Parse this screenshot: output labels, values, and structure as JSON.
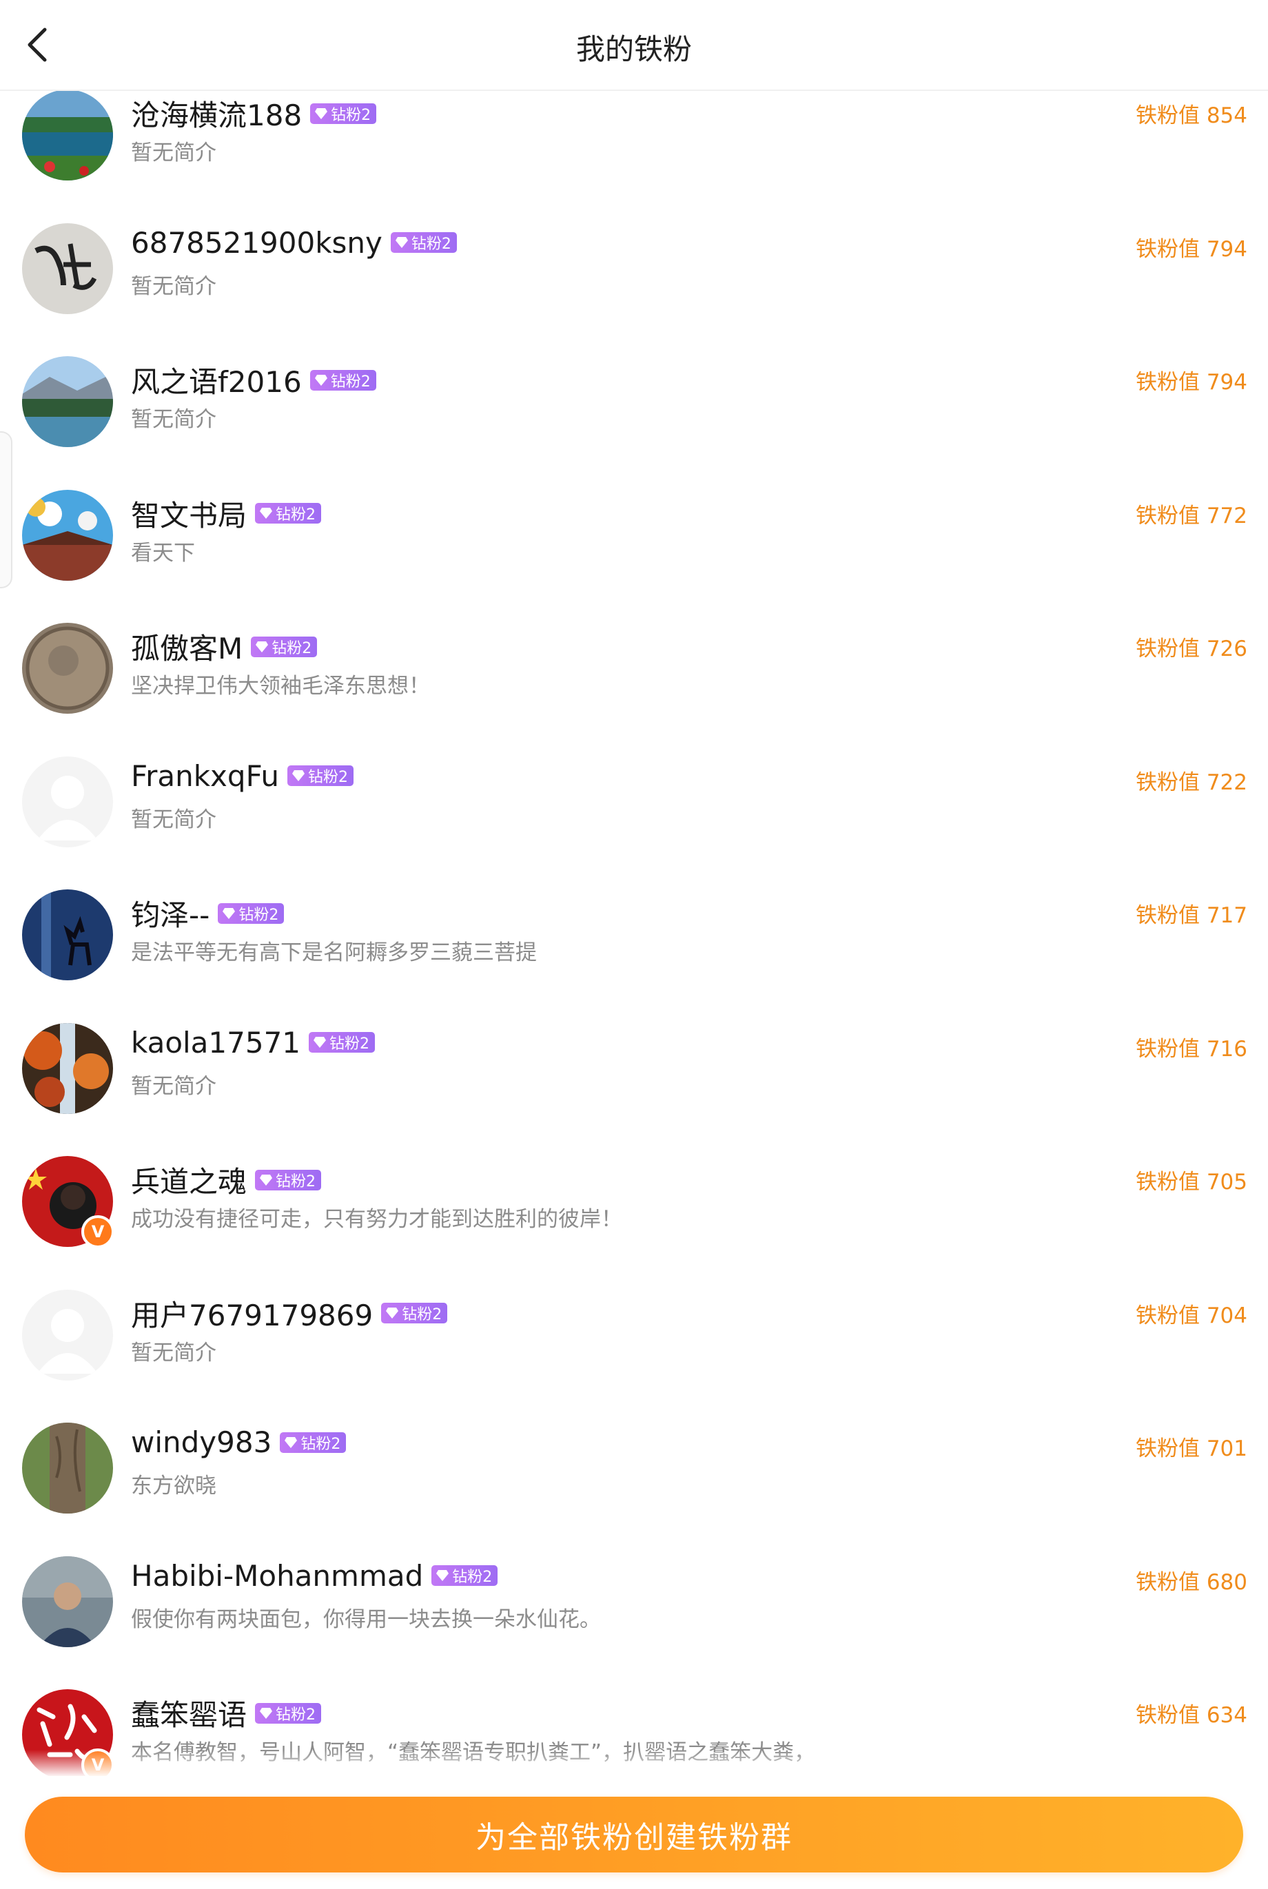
{
  "header": {
    "title": "我的铁粉"
  },
  "badge_label": "钻粉2",
  "colors": {
    "accent": "#f08c1c",
    "badge": "#b070f4",
    "cta_start": "#ff8a1f",
    "cta_end": "#ffb22a"
  },
  "fans": [
    {
      "name": "沧海横流188",
      "bio": "暂无简介",
      "score": "铁粉值 854",
      "avatar": "lake-landscape",
      "verified": false
    },
    {
      "name": "6878521900ksny",
      "bio": "暂无简介",
      "score": "铁粉值 794",
      "avatar": "calligraphy",
      "verified": false
    },
    {
      "name": "风之语f2016",
      "bio": "暂无简介",
      "score": "铁粉值 794",
      "avatar": "river-forest",
      "verified": false
    },
    {
      "name": "智文书局",
      "bio": "看天下",
      "score": "铁粉值 772",
      "avatar": "pavilion-sky",
      "verified": false
    },
    {
      "name": "孤傲客M",
      "bio": "坚决捍卫伟大领袖毛泽东思想！",
      "score": "铁粉值 726",
      "avatar": "old-coin",
      "verified": false
    },
    {
      "name": "FrankxqFu",
      "bio": "暂无简介",
      "score": "铁粉值 722",
      "avatar": "default-user",
      "verified": false
    },
    {
      "name": "钧泽--",
      "bio": "是法平等无有高下是名阿耨多罗三藐三菩提",
      "score": "铁粉值 717",
      "avatar": "deer-night",
      "verified": false
    },
    {
      "name": "kaola17571",
      "bio": "暂无简介",
      "score": "铁粉值 716",
      "avatar": "autumn-waterfall",
      "verified": false
    },
    {
      "name": "兵道之魂",
      "bio": "成功没有捷径可走，只有努力才能到达胜利的彼岸！",
      "score": "铁粉值 705",
      "avatar": "red-flag-portrait",
      "verified": true
    },
    {
      "name": "用户7679179869",
      "bio": "暂无简介",
      "score": "铁粉值 704",
      "avatar": "default-user",
      "verified": false
    },
    {
      "name": "windy983",
      "bio": "东方欲晓",
      "score": "铁粉值 701",
      "avatar": "tree-trunk",
      "verified": false
    },
    {
      "name": "Habibi-Mohanmmad",
      "bio": "假使你有两块面包，你得用一块去换一朵水仙花。",
      "score": "铁粉值 680",
      "avatar": "man-portrait",
      "verified": false
    },
    {
      "name": "蠢笨罂语",
      "bio": "本名傅教智，号山人阿智，“蠢笨罂语专职扒粪工”，扒罂语之蠢笨大粪，",
      "score": "铁粉值 634",
      "avatar": "red-calligraphy",
      "verified": true
    }
  ],
  "verified_mark": "V",
  "cta": {
    "label": "为全部铁粉创建铁粉群"
  }
}
